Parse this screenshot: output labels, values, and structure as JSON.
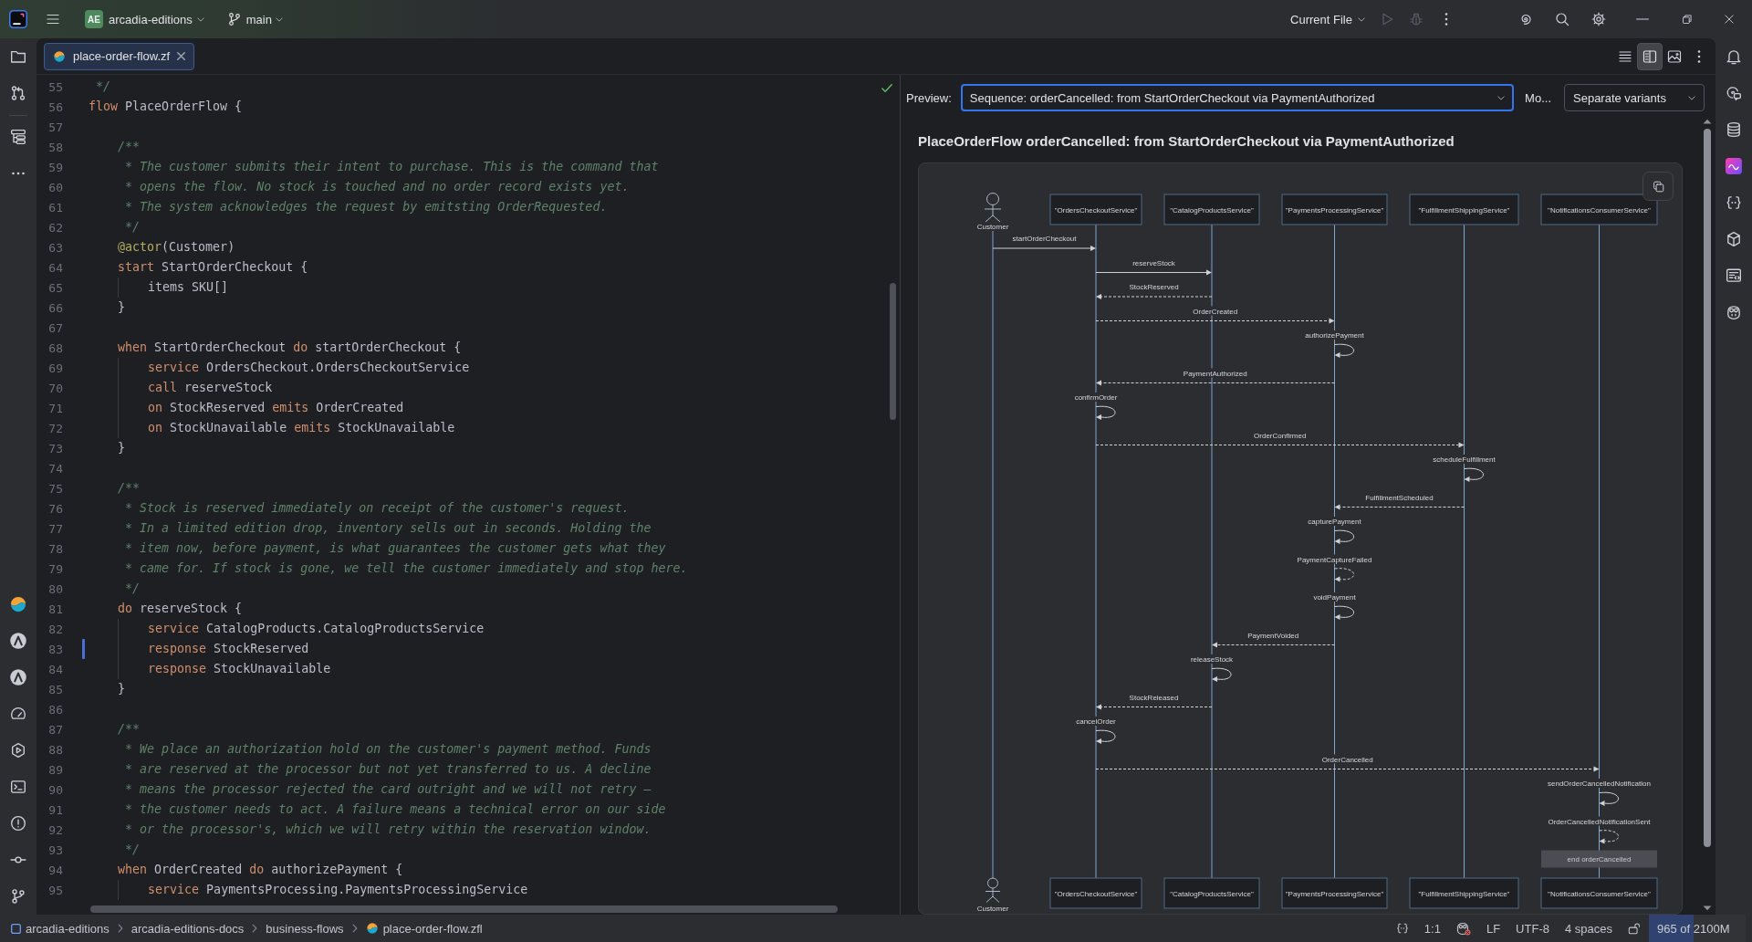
{
  "title_bar": {
    "project_badge": "AE",
    "project": "arcadia-editions",
    "branch": "main",
    "run_configuration": "Current File",
    "run_actions": [
      {
        "kind": "run",
        "disabled": true
      },
      {
        "kind": "debug",
        "disabled": true
      }
    ]
  },
  "editor_tabs": [
    {
      "label": "place-order-flow.zf",
      "selected": true
    }
  ],
  "view_modes": [
    {
      "kind": "editor",
      "selected": false
    },
    {
      "kind": "split",
      "selected": true
    },
    {
      "kind": "preview",
      "selected": false
    }
  ],
  "editor": {
    "lines": [
      {
        "number": "55",
        "modified": false,
        "tokens": [
          {
            "kind": "comment",
            "text": " */"
          }
        ]
      },
      {
        "number": "56",
        "modified": false,
        "tokens": [
          {
            "kind": "keyword",
            "text": "flow"
          },
          {
            "kind": "plain",
            "text": " PlaceOrderFlow {"
          }
        ]
      },
      {
        "number": "57",
        "modified": false
      },
      {
        "number": "58",
        "modified": false,
        "tokens": [
          {
            "kind": "comment",
            "text": "    /**"
          }
        ]
      },
      {
        "number": "59",
        "modified": false,
        "tokens": [
          {
            "kind": "comment",
            "text": "     * The customer submits their intent to purchase. This is the command that"
          }
        ]
      },
      {
        "number": "60",
        "modified": false,
        "tokens": [
          {
            "kind": "comment",
            "text": "     * opens the flow. No stock is touched and no order record exists yet."
          }
        ]
      },
      {
        "number": "61",
        "modified": false,
        "tokens": [
          {
            "kind": "comment",
            "text": "     * The system acknowledges the request by emitsting OrderRequested."
          }
        ]
      },
      {
        "number": "62",
        "modified": false,
        "tokens": [
          {
            "kind": "comment",
            "text": "     */"
          }
        ]
      },
      {
        "number": "63",
        "modified": false,
        "tokens": [
          {
            "kind": "annotation",
            "text": "    @actor"
          },
          {
            "kind": "plain",
            "text": "(Customer)"
          }
        ]
      },
      {
        "number": "64",
        "modified": false,
        "tokens": [
          {
            "kind": "keyword",
            "text": "    start"
          },
          {
            "kind": "plain",
            "text": " StartOrderCheckout {"
          }
        ]
      },
      {
        "number": "65",
        "modified": false,
        "tokens": [
          {
            "kind": "plain",
            "text": "        items SKU[]"
          }
        ]
      },
      {
        "number": "66",
        "modified": false,
        "tokens": [
          {
            "kind": "plain",
            "text": "    }"
          }
        ]
      },
      {
        "number": "67",
        "modified": false
      },
      {
        "number": "68",
        "modified": false,
        "tokens": [
          {
            "kind": "keyword",
            "text": "    when"
          },
          {
            "kind": "plain",
            "text": " StartOrderCheckout "
          },
          {
            "kind": "keyword",
            "text": "do"
          },
          {
            "kind": "plain",
            "text": " startOrderCheckout {"
          }
        ]
      },
      {
        "number": "69",
        "modified": false,
        "tokens": [
          {
            "kind": "keyword",
            "text": "        service"
          },
          {
            "kind": "plain",
            "text": " OrdersCheckout.OrdersCheckoutService"
          }
        ]
      },
      {
        "number": "70",
        "modified": false,
        "tokens": [
          {
            "kind": "keyword",
            "text": "        call"
          },
          {
            "kind": "plain",
            "text": " reserveStock"
          }
        ]
      },
      {
        "number": "71",
        "modified": false,
        "tokens": [
          {
            "kind": "keyword",
            "text": "        on"
          },
          {
            "kind": "plain",
            "text": " StockReserved "
          },
          {
            "kind": "keyword",
            "text": "emits"
          },
          {
            "kind": "plain",
            "text": " OrderCreated"
          }
        ]
      },
      {
        "number": "72",
        "modified": false,
        "tokens": [
          {
            "kind": "keyword",
            "text": "        on"
          },
          {
            "kind": "plain",
            "text": " StockUnavailable "
          },
          {
            "kind": "keyword",
            "text": "emits"
          },
          {
            "kind": "plain",
            "text": " StockUnavailable"
          }
        ]
      },
      {
        "number": "73",
        "modified": false,
        "tokens": [
          {
            "kind": "plain",
            "text": "    }"
          }
        ]
      },
      {
        "number": "74",
        "modified": false
      },
      {
        "number": "75",
        "modified": false,
        "tokens": [
          {
            "kind": "comment",
            "text": "    /**"
          }
        ]
      },
      {
        "number": "76",
        "modified": false,
        "tokens": [
          {
            "kind": "comment",
            "text": "     * Stock is reserved immediately on receipt of the customer's request."
          }
        ]
      },
      {
        "number": "77",
        "modified": false,
        "tokens": [
          {
            "kind": "comment",
            "text": "     * In a limited edition drop, inventory sells out in seconds. Holding the"
          }
        ]
      },
      {
        "number": "78",
        "modified": false,
        "tokens": [
          {
            "kind": "comment",
            "text": "     * item now, before payment, is what guarantees the customer gets what they"
          }
        ]
      },
      {
        "number": "79",
        "modified": false,
        "tokens": [
          {
            "kind": "comment",
            "text": "     * came for. If stock is gone, we tell the customer immediately and stop here."
          }
        ]
      },
      {
        "number": "80",
        "modified": false,
        "tokens": [
          {
            "kind": "comment",
            "text": "     */"
          }
        ]
      },
      {
        "number": "81",
        "modified": false,
        "tokens": [
          {
            "kind": "keyword",
            "text": "    do"
          },
          {
            "kind": "plain",
            "text": " reserveStock {"
          }
        ]
      },
      {
        "number": "82",
        "modified": false,
        "tokens": [
          {
            "kind": "keyword",
            "text": "        service"
          },
          {
            "kind": "plain",
            "text": " CatalogProducts.CatalogProductsService"
          }
        ]
      },
      {
        "number": "83",
        "modified": true,
        "tokens": [
          {
            "kind": "keyword",
            "text": "        response"
          },
          {
            "kind": "plain",
            "text": " StockReserved"
          }
        ]
      },
      {
        "number": "84",
        "modified": false,
        "tokens": [
          {
            "kind": "keyword",
            "text": "        response"
          },
          {
            "kind": "plain",
            "text": " StockUnavailable"
          }
        ]
      },
      {
        "number": "85",
        "modified": false,
        "tokens": [
          {
            "kind": "plain",
            "text": "    }"
          }
        ]
      },
      {
        "number": "86",
        "modified": false
      },
      {
        "number": "87",
        "modified": false,
        "tokens": [
          {
            "kind": "comment",
            "text": "    /**"
          }
        ]
      },
      {
        "number": "88",
        "modified": false,
        "tokens": [
          {
            "kind": "comment",
            "text": "     * We place an authorization hold on the customer's payment method. Funds"
          }
        ]
      },
      {
        "number": "89",
        "modified": false,
        "tokens": [
          {
            "kind": "comment",
            "text": "     * are reserved at the processor but not yet transferred to us. A decline"
          }
        ]
      },
      {
        "number": "90",
        "modified": false,
        "tokens": [
          {
            "kind": "comment",
            "text": "     * means the processor rejected the card outright and we will not retry —"
          }
        ]
      },
      {
        "number": "91",
        "modified": false,
        "tokens": [
          {
            "kind": "comment",
            "text": "     * the customer needs to act. A failure means a technical error on our side"
          }
        ]
      },
      {
        "number": "92",
        "modified": false,
        "tokens": [
          {
            "kind": "comment",
            "text": "     * or the processor's, which we will retry within the reservation window."
          }
        ]
      },
      {
        "number": "93",
        "modified": false,
        "tokens": [
          {
            "kind": "comment",
            "text": "     */"
          }
        ]
      },
      {
        "number": "94",
        "modified": false,
        "tokens": [
          {
            "kind": "keyword",
            "text": "    when"
          },
          {
            "kind": "plain",
            "text": " OrderCreated "
          },
          {
            "kind": "keyword",
            "text": "do"
          },
          {
            "kind": "plain",
            "text": " authorizePayment {"
          }
        ]
      },
      {
        "number": "95",
        "modified": false,
        "tokens": [
          {
            "kind": "keyword",
            "text": "        service"
          },
          {
            "kind": "plain",
            "text": " PaymentsProcessing.PaymentsProcessingService"
          }
        ]
      }
    ]
  },
  "preview": {
    "label": "Preview:",
    "diagram_select": {
      "value": "Sequence: orderCancelled: from StartOrderCheckout via PaymentAuthorized",
      "focused": true
    },
    "mode_label": "Mo...",
    "variants_select": {
      "value": "Separate variants"
    },
    "title": "PlaceOrderFlow orderCancelled: from StartOrderCheckout via PaymentAuthorized",
    "diagram": {
      "participants": [
        {
          "kind": "actor",
          "label_top": "Customer",
          "label_bottom": "Customer"
        },
        {
          "kind": "service",
          "label_top": "\"OrdersCheckoutService\"",
          "label_bottom": "\"OrdersCheckoutService\""
        },
        {
          "kind": "service",
          "label_top": "\"CatalogProductsService\"",
          "label_bottom": "\"CatalogProductsService\""
        },
        {
          "kind": "service",
          "label_top": "\"PaymentsProcessingService\"",
          "label_bottom": "\"PaymentsProcessingService\""
        },
        {
          "kind": "service",
          "label_top": "\"FulfillmentShippingService\"",
          "label_bottom": "\"FulfillmentShippingService\""
        },
        {
          "kind": "service",
          "label_top": "\"NotificationsConsumerService\"",
          "label_bottom": "\"NotificationsConsumerService\""
        }
      ],
      "messages": [
        {
          "label": "startOrderCheckout",
          "kind": "call",
          "lanes": [
            {
              "kind": "from"
            },
            {
              "kind": "to"
            },
            {
              "kind": "none"
            },
            {
              "kind": "none"
            },
            {
              "kind": "none"
            },
            {
              "kind": "none"
            }
          ]
        },
        {
          "label": "reserveStock",
          "kind": "call",
          "lanes": [
            {
              "kind": "none"
            },
            {
              "kind": "from"
            },
            {
              "kind": "to"
            },
            {
              "kind": "none"
            },
            {
              "kind": "none"
            },
            {
              "kind": "none"
            }
          ]
        },
        {
          "label": "StockReserved",
          "kind": "event",
          "lanes": [
            {
              "kind": "none"
            },
            {
              "kind": "to"
            },
            {
              "kind": "from"
            },
            {
              "kind": "none"
            },
            {
              "kind": "none"
            },
            {
              "kind": "none"
            }
          ]
        },
        {
          "label": "OrderCreated",
          "kind": "event",
          "lanes": [
            {
              "kind": "none"
            },
            {
              "kind": "from"
            },
            {
              "kind": "none"
            },
            {
              "kind": "to"
            },
            {
              "kind": "none"
            },
            {
              "kind": "none"
            }
          ]
        },
        {
          "label": "authorizePayment",
          "kind": "call",
          "lanes": [
            {
              "kind": "none"
            },
            {
              "kind": "none"
            },
            {
              "kind": "none"
            },
            {
              "kind": "self"
            },
            {
              "kind": "none"
            },
            {
              "kind": "none"
            }
          ]
        },
        {
          "label": "PaymentAuthorized",
          "kind": "event",
          "lanes": [
            {
              "kind": "none"
            },
            {
              "kind": "to"
            },
            {
              "kind": "none"
            },
            {
              "kind": "from"
            },
            {
              "kind": "none"
            },
            {
              "kind": "none"
            }
          ]
        },
        {
          "label": "confirmOrder",
          "kind": "call",
          "lanes": [
            {
              "kind": "none"
            },
            {
              "kind": "self"
            },
            {
              "kind": "none"
            },
            {
              "kind": "none"
            },
            {
              "kind": "none"
            },
            {
              "kind": "none"
            }
          ]
        },
        {
          "label": "OrderConfirmed",
          "kind": "event",
          "lanes": [
            {
              "kind": "none"
            },
            {
              "kind": "from"
            },
            {
              "kind": "none"
            },
            {
              "kind": "none"
            },
            {
              "kind": "to"
            },
            {
              "kind": "none"
            }
          ]
        },
        {
          "label": "scheduleFulfillment",
          "kind": "call",
          "lanes": [
            {
              "kind": "none"
            },
            {
              "kind": "none"
            },
            {
              "kind": "none"
            },
            {
              "kind": "none"
            },
            {
              "kind": "self"
            },
            {
              "kind": "none"
            }
          ]
        },
        {
          "label": "FulfillmentScheduled",
          "kind": "event",
          "lanes": [
            {
              "kind": "none"
            },
            {
              "kind": "none"
            },
            {
              "kind": "none"
            },
            {
              "kind": "to"
            },
            {
              "kind": "from"
            },
            {
              "kind": "none"
            }
          ]
        },
        {
          "label": "capturePayment",
          "kind": "call",
          "lanes": [
            {
              "kind": "none"
            },
            {
              "kind": "none"
            },
            {
              "kind": "none"
            },
            {
              "kind": "self"
            },
            {
              "kind": "none"
            },
            {
              "kind": "none"
            }
          ]
        },
        {
          "label": "PaymentCaptureFailed",
          "kind": "event",
          "lanes": [
            {
              "kind": "none"
            },
            {
              "kind": "none"
            },
            {
              "kind": "none"
            },
            {
              "kind": "self"
            },
            {
              "kind": "none"
            },
            {
              "kind": "none"
            }
          ]
        },
        {
          "label": "voidPayment",
          "kind": "call",
          "lanes": [
            {
              "kind": "none"
            },
            {
              "kind": "none"
            },
            {
              "kind": "none"
            },
            {
              "kind": "self"
            },
            {
              "kind": "none"
            },
            {
              "kind": "none"
            }
          ]
        },
        {
          "label": "PaymentVoided",
          "kind": "event",
          "lanes": [
            {
              "kind": "none"
            },
            {
              "kind": "none"
            },
            {
              "kind": "to"
            },
            {
              "kind": "from"
            },
            {
              "kind": "none"
            },
            {
              "kind": "none"
            }
          ]
        },
        {
          "label": "releaseStock",
          "kind": "call",
          "lanes": [
            {
              "kind": "none"
            },
            {
              "kind": "none"
            },
            {
              "kind": "self"
            },
            {
              "kind": "none"
            },
            {
              "kind": "none"
            },
            {
              "kind": "none"
            }
          ]
        },
        {
          "label": "StockReleased",
          "kind": "event",
          "lanes": [
            {
              "kind": "none"
            },
            {
              "kind": "to"
            },
            {
              "kind": "from"
            },
            {
              "kind": "none"
            },
            {
              "kind": "none"
            },
            {
              "kind": "none"
            }
          ]
        },
        {
          "label": "cancelOrder",
          "kind": "call",
          "lanes": [
            {
              "kind": "none"
            },
            {
              "kind": "self"
            },
            {
              "kind": "none"
            },
            {
              "kind": "none"
            },
            {
              "kind": "none"
            },
            {
              "kind": "none"
            }
          ]
        },
        {
          "label": "OrderCancelled",
          "kind": "event",
          "lanes": [
            {
              "kind": "none"
            },
            {
              "kind": "from"
            },
            {
              "kind": "none"
            },
            {
              "kind": "none"
            },
            {
              "kind": "none"
            },
            {
              "kind": "to"
            }
          ]
        },
        {
          "label": "sendOrderCancelledNotification",
          "kind": "call",
          "lanes": [
            {
              "kind": "none"
            },
            {
              "kind": "none"
            },
            {
              "kind": "none"
            },
            {
              "kind": "none"
            },
            {
              "kind": "none"
            },
            {
              "kind": "self"
            }
          ]
        },
        {
          "label": "OrderCancelledNotificationSent",
          "kind": "event",
          "lanes": [
            {
              "kind": "none"
            },
            {
              "kind": "none"
            },
            {
              "kind": "none"
            },
            {
              "kind": "none"
            },
            {
              "kind": "none"
            },
            {
              "kind": "self"
            }
          ]
        }
      ],
      "end_note": "end orderCancelled"
    }
  },
  "status_bar": {
    "breadcrumbs": [
      {
        "kind": "module",
        "label": "arcadia-editions"
      },
      {
        "kind": "folder",
        "label": "arcadia-editions-docs"
      },
      {
        "kind": "folder",
        "label": "business-flows"
      },
      {
        "kind": "file",
        "label": "place-order-flow.zfl"
      }
    ],
    "position": "1:1",
    "line_separator": "LF",
    "encoding": "UTF-8",
    "indent": "4 spaces",
    "memory": {
      "reading": "965 of 2100M",
      "level": 0.46
    }
  }
}
